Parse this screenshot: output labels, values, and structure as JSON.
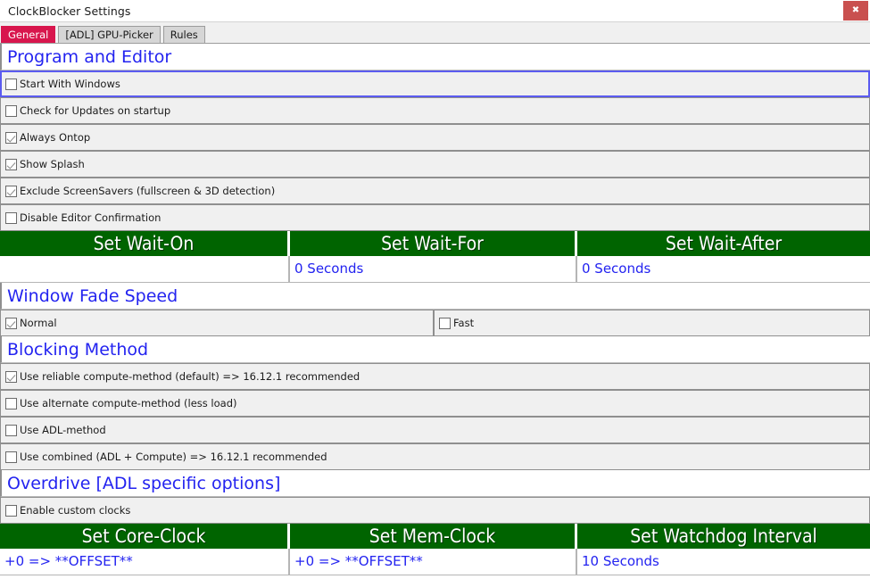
{
  "window": {
    "title": "ClockBlocker Settings",
    "close_label": "✖"
  },
  "colors": {
    "accent_tab": "#d8164d",
    "heading_blue": "#2323f0",
    "grid_green": "#006400",
    "close_red": "#c9504f",
    "focus_border": "#5b5bf0"
  },
  "tabs": [
    {
      "label": "General",
      "active": true
    },
    {
      "label": "[ADL] GPU-Picker",
      "active": false
    },
    {
      "label": "Rules",
      "active": false
    }
  ],
  "sections": {
    "program_and_editor": {
      "heading": "Program and Editor",
      "options": [
        {
          "label": "Start With Windows",
          "checked": false,
          "focused": true
        },
        {
          "label": "Check for Updates on startup",
          "checked": false,
          "focused": false
        },
        {
          "label": "Always Ontop",
          "checked": true,
          "focused": false
        },
        {
          "label": "Show Splash",
          "checked": true,
          "focused": false
        },
        {
          "label": "Exclude ScreenSavers (fullscreen & 3D detection)",
          "checked": true,
          "focused": false
        },
        {
          "label": "Disable Editor Confirmation",
          "checked": false,
          "focused": false
        }
      ]
    },
    "wait_grid": {
      "headers": [
        "Set Wait-On",
        "Set Wait-For",
        "Set Wait-After"
      ],
      "values": [
        "",
        "0 Seconds",
        "0 Seconds"
      ]
    },
    "window_fade_speed": {
      "heading": "Window Fade Speed",
      "options": [
        {
          "label": "Normal",
          "checked": true
        },
        {
          "label": "Fast",
          "checked": false
        }
      ]
    },
    "blocking_method": {
      "heading": "Blocking Method",
      "options": [
        {
          "label": "Use reliable compute-method (default) => 16.12.1 recommended",
          "checked": true
        },
        {
          "label": "Use alternate compute-method (less load)",
          "checked": false
        },
        {
          "label": "Use ADL-method",
          "checked": false
        },
        {
          "label": "Use combined (ADL + Compute) => 16.12.1 recommended",
          "checked": false
        }
      ]
    },
    "overdrive": {
      "heading": "Overdrive [ADL specific options]",
      "options": [
        {
          "label": "Enable custom clocks",
          "checked": false
        }
      ]
    },
    "clock_grid": {
      "headers": [
        "Set Core-Clock",
        "Set Mem-Clock",
        "Set Watchdog Interval"
      ],
      "values": [
        "+0 => **OFFSET**",
        "+0 => **OFFSET**",
        "10 Seconds"
      ]
    }
  }
}
